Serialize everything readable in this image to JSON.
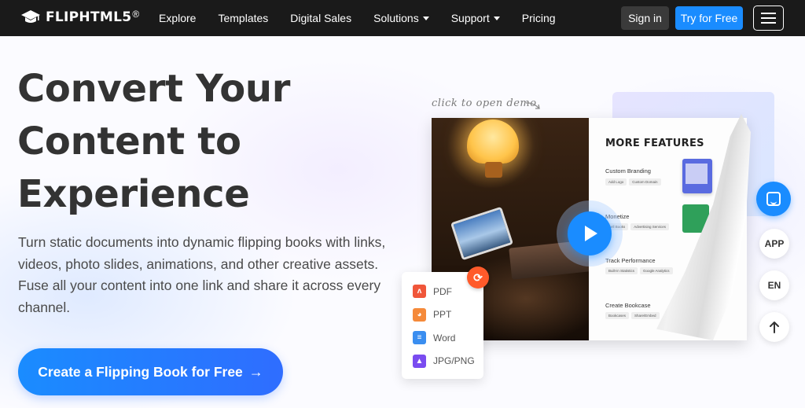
{
  "nav": {
    "brand": "FLIPHTML5",
    "brand_mark": "®",
    "links": [
      {
        "label": "Explore",
        "has_caret": false
      },
      {
        "label": "Templates",
        "has_caret": false
      },
      {
        "label": "Digital Sales",
        "has_caret": false
      },
      {
        "label": "Solutions",
        "has_caret": true
      },
      {
        "label": "Support",
        "has_caret": true
      },
      {
        "label": "Pricing",
        "has_caret": false
      }
    ],
    "sign_in": "Sign in",
    "try_free": "Try for Free"
  },
  "hero": {
    "headline_lines": [
      "Convert Your",
      "Content to",
      "Experience"
    ],
    "subtext": "Turn static documents into dynamic flipping books with links, videos, photo slides, animations, and other creative assets. Fuse all your content into one link and share it across every channel.",
    "cta_label": "Create a Flipping Book for Free",
    "cta_arrow": "→"
  },
  "demo": {
    "hint": "click to open demo",
    "features_title": "MORE FEATURES",
    "features": [
      {
        "name": "Custom Branding",
        "chips": [
          "Add Logo",
          "Custom Domain"
        ]
      },
      {
        "name": "Monetize",
        "chips": [
          "Sell Books",
          "Advertising Services"
        ]
      },
      {
        "name": "Track Performance",
        "chips": [
          "Built-in Statistics",
          "Google Analytics"
        ]
      },
      {
        "name": "Create Bookcase",
        "chips": [
          "Bookcases",
          "Share/Embed"
        ]
      }
    ],
    "formats": [
      {
        "label": "PDF",
        "icon": "pdf-icon",
        "color": "#f0563a"
      },
      {
        "label": "PPT",
        "icon": "ppt-icon",
        "color": "#f58a3a"
      },
      {
        "label": "Word",
        "icon": "word-icon",
        "color": "#3a8ef0"
      },
      {
        "label": "JPG/PNG",
        "icon": "image-icon",
        "color": "#7a4cf0"
      }
    ]
  },
  "side": {
    "app": "APP",
    "lang": "EN"
  },
  "colors": {
    "accent": "#1a8cff",
    "nav_bg": "#1a1a1a",
    "headline": "#333333"
  }
}
